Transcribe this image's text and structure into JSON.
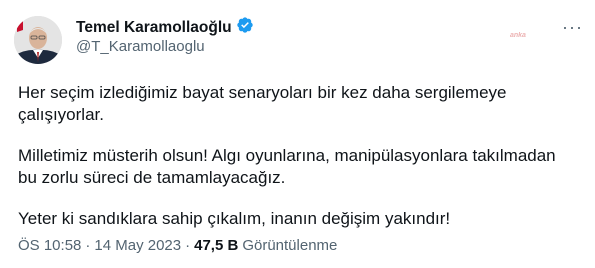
{
  "author": {
    "display_name": "Temel Karamollaoğlu",
    "handle": "@T_Karamollaoglu",
    "verified": true
  },
  "watermark": "anka",
  "tweet": {
    "paragraphs": [
      "Her seçim izlediğimiz bayat senaryoları bir kez daha sergilemeye çalışıyorlar.",
      "Milletimiz müsterih olsun! Algı oyunlarına, manipülasyonlara takılmadan bu zorlu süreci de tamamlayacağız.",
      "Yeter ki sandıklara sahip çıkalım, inanın değişim yakındır!"
    ]
  },
  "meta": {
    "time": "ÖS 10:58",
    "separator": "·",
    "date": "14 May 2023",
    "separator2": "·",
    "views_count": "47,5 B",
    "views_label": "Görüntülenme"
  },
  "colors": {
    "verified_blue": "#1d9bf0",
    "text_primary": "#0f1419",
    "text_secondary": "#536471"
  }
}
